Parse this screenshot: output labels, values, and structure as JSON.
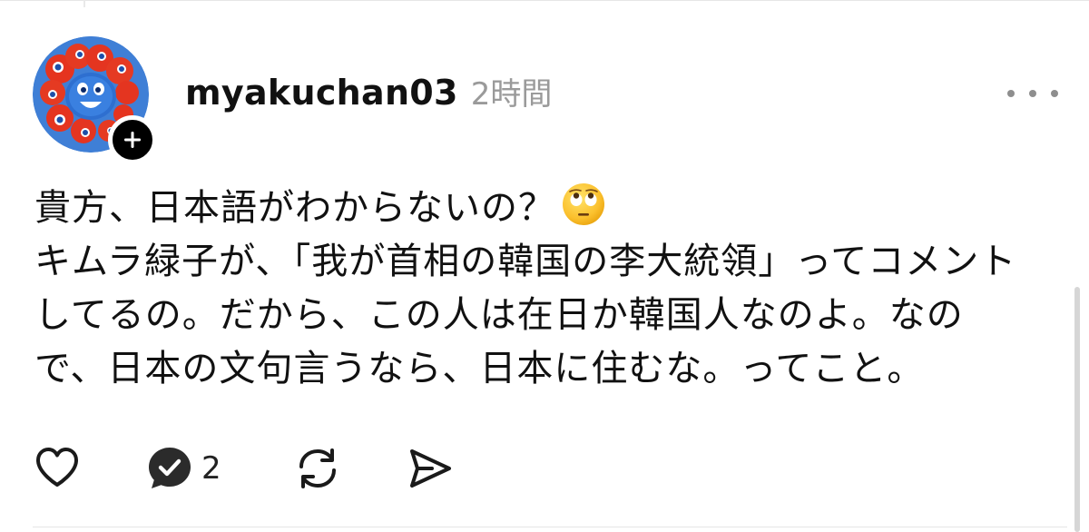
{
  "post": {
    "username": "myakuchan03",
    "time": "2時間",
    "body_lines": [
      "貴方、日本語がわからないの？",
      "キムラ緑子が、「我が首相の韓国の李大統領」ってコメント",
      "してるの。だから、この人は在日か韓国人なのよ。なの",
      "で、日本の文句言うなら、日本に住むな。ってこと。"
    ],
    "emoji": "face-with-rolling-eyes-emoji"
  },
  "actions": {
    "like_icon": "heart-icon",
    "reply_icon": "reply-bubble-icon",
    "reply_count": "2",
    "repost_icon": "repost-icon",
    "share_icon": "send-icon"
  },
  "icons": {
    "more": "more-dots-icon",
    "follow": "plus-icon"
  }
}
